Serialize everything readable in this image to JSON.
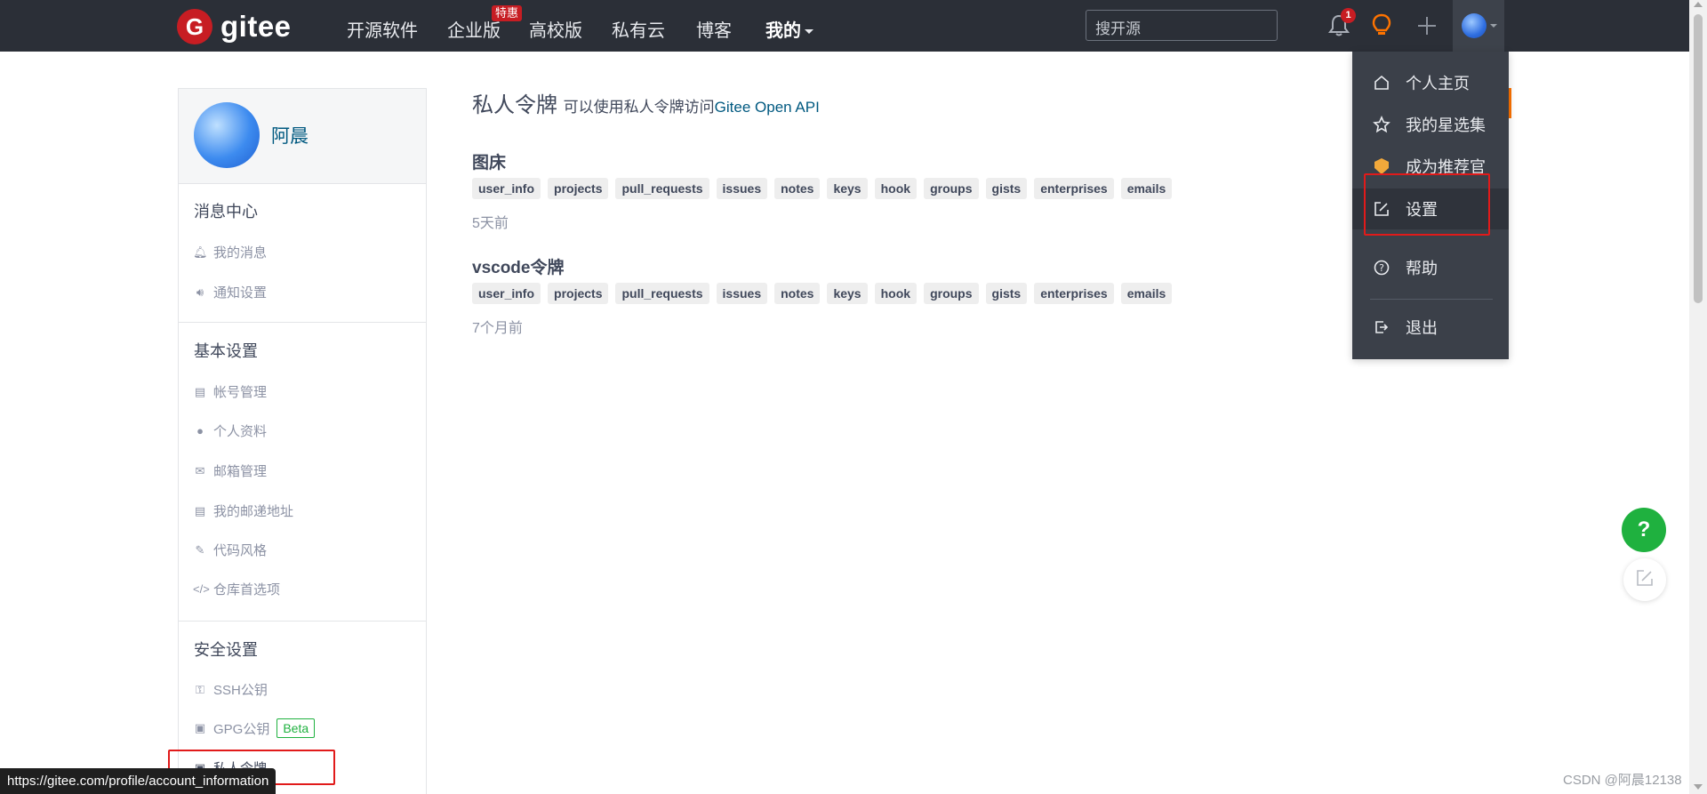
{
  "nav": {
    "logo_mark": "G",
    "logo_text": "gitee",
    "items": [
      "开源软件",
      "企业版",
      "高校版",
      "私有云",
      "博客",
      "我的"
    ],
    "badge": "特惠",
    "search_placeholder": "搜开源",
    "notification_count": "1"
  },
  "sidebar": {
    "username": "阿晨",
    "sections": [
      {
        "title": "消息中心",
        "items": [
          "我的消息",
          "通知设置"
        ]
      },
      {
        "title": "基本设置",
        "items": [
          "帐号管理",
          "个人资料",
          "邮箱管理",
          "我的邮递地址",
          "代码风格",
          "仓库首选项"
        ]
      },
      {
        "title": "安全设置",
        "items": [
          "SSH公钥",
          "GPG公钥",
          "私人令牌"
        ]
      }
    ],
    "beta_label": "Beta"
  },
  "main": {
    "title": "私人令牌",
    "subtitle_prefix": "可以使用私人令牌访问",
    "subtitle_link": "Gitee Open API",
    "tokens": [
      {
        "name": "图床",
        "scopes": [
          "user_info",
          "projects",
          "pull_requests",
          "issues",
          "notes",
          "keys",
          "hook",
          "groups",
          "gists",
          "enterprises",
          "emails"
        ],
        "time": "5天前"
      },
      {
        "name": "vscode令牌",
        "scopes": [
          "user_info",
          "projects",
          "pull_requests",
          "issues",
          "notes",
          "keys",
          "hook",
          "groups",
          "gists",
          "enterprises",
          "emails"
        ],
        "time": "7个月前"
      }
    ]
  },
  "dropdown": {
    "items": [
      "个人主页",
      "我的星选集",
      "成为推荐官",
      "设置",
      "帮助",
      "退出"
    ],
    "active": "设置"
  },
  "help_button": "?",
  "status_url": "https://gitee.com/profile/account_information",
  "watermark": "CSDN @阿晨12138",
  "colors": {
    "nav_bg": "#2b2f37",
    "brand_red": "#c71d23",
    "link": "#005980",
    "green": "#1fb13f",
    "highlight_red": "#e11a1a"
  }
}
